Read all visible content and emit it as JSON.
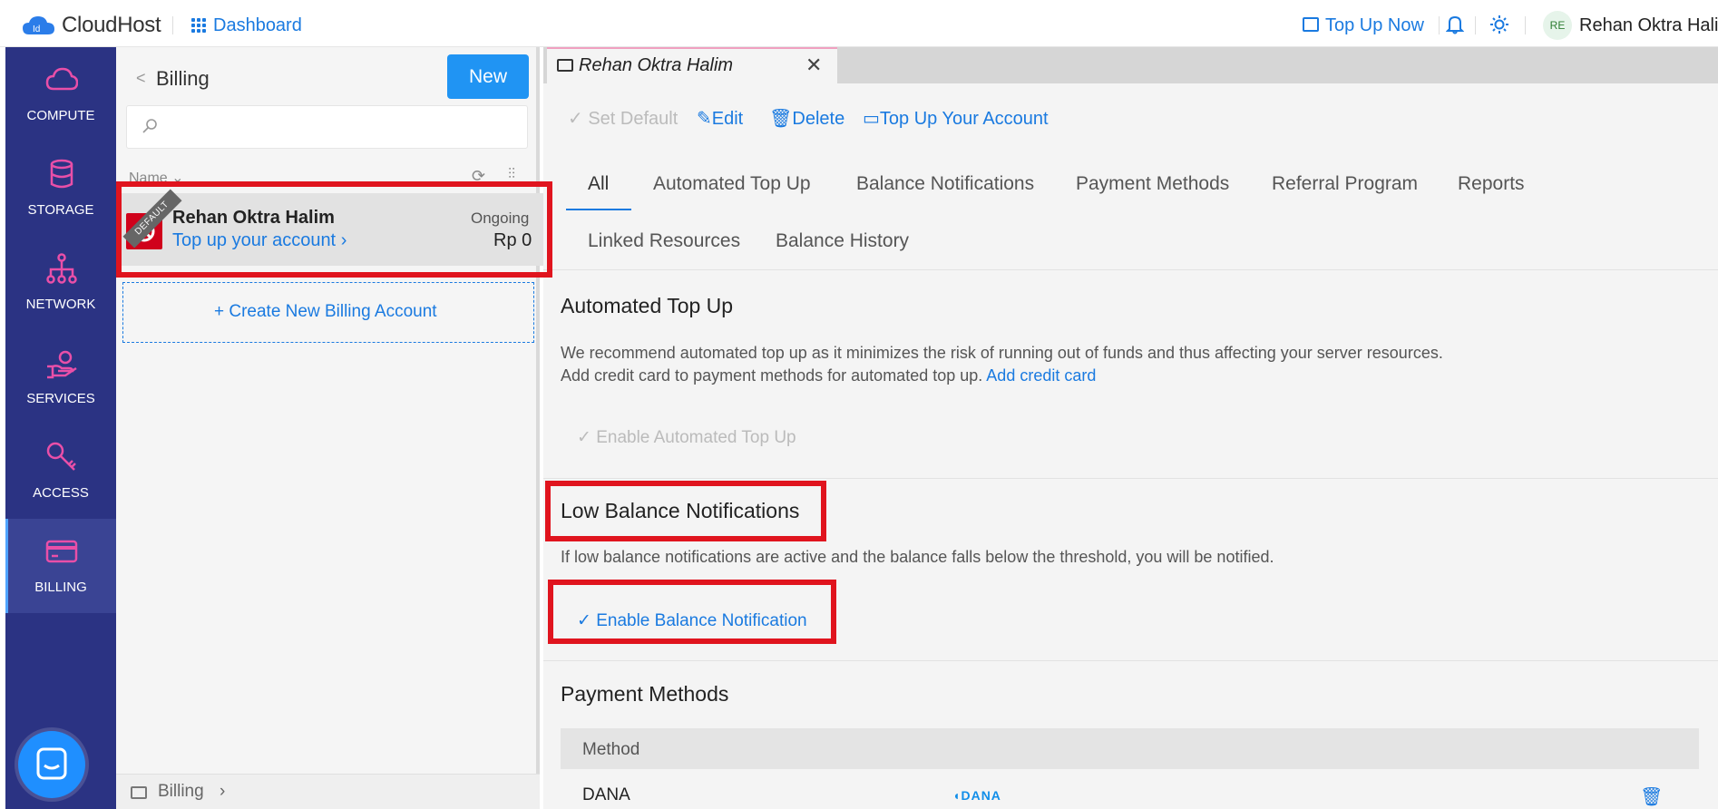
{
  "header": {
    "logo_text": "CloudHost",
    "logo_badge": "Id",
    "dashboard": "Dashboard",
    "top_up_now": "Top Up Now",
    "avatar_initials": "RE",
    "user_name": "Rehan Oktra Halim"
  },
  "sidebar": {
    "items": [
      {
        "label": "COMPUTE",
        "icon": "cloud-icon"
      },
      {
        "label": "STORAGE",
        "icon": "database-icon"
      },
      {
        "label": "NETWORK",
        "icon": "network-icon"
      },
      {
        "label": "SERVICES",
        "icon": "services-icon"
      },
      {
        "label": "ACCESS",
        "icon": "key-icon"
      },
      {
        "label": "BILLING",
        "icon": "credit-card-icon",
        "active": true
      }
    ],
    "accent_color": "#e94fa8"
  },
  "billing_list": {
    "back": "<",
    "title": "Billing",
    "new_button": "New",
    "search_placeholder": "",
    "name_header": "Name",
    "account": {
      "ribbon": "DEFAULT",
      "name": "Rehan Oktra Halim",
      "link": "Top up your account",
      "status": "Ongoing",
      "balance": "Rp 0"
    },
    "create_new": "+ Create New Billing Account",
    "footer": "Billing"
  },
  "detail": {
    "tab_title": "Rehan Oktra Halim",
    "actions": {
      "set_default": "Set Default",
      "edit": "Edit",
      "delete": "Delete",
      "top_up": "Top Up Your Account"
    },
    "tabs": [
      "All",
      "Automated Top Up",
      "Balance Notifications",
      "Payment Methods",
      "Referral Program",
      "Reports",
      "Linked Resources",
      "Balance History"
    ],
    "automated_top_up": {
      "title": "Automated Top Up",
      "desc1": "We recommend automated top up as it minimizes the risk of running out of funds and thus affecting your server resources.",
      "desc2": "Add credit card to payment methods for automated top up.",
      "desc2_link": "Add credit card",
      "button": "Enable Automated Top Up"
    },
    "low_balance": {
      "title": "Low Balance Notifications",
      "desc": "If low balance notifications are active and the balance falls below the threshold, you will be notified.",
      "button": "Enable Balance Notification"
    },
    "payment_methods": {
      "title": "Payment Methods",
      "column": "Method",
      "rows": [
        {
          "method": "DANA",
          "logo": "DANA"
        }
      ]
    }
  },
  "colors": {
    "primary": "#1a7ae0",
    "nav_bg": "#2b3383",
    "highlight": "#e0141e"
  }
}
